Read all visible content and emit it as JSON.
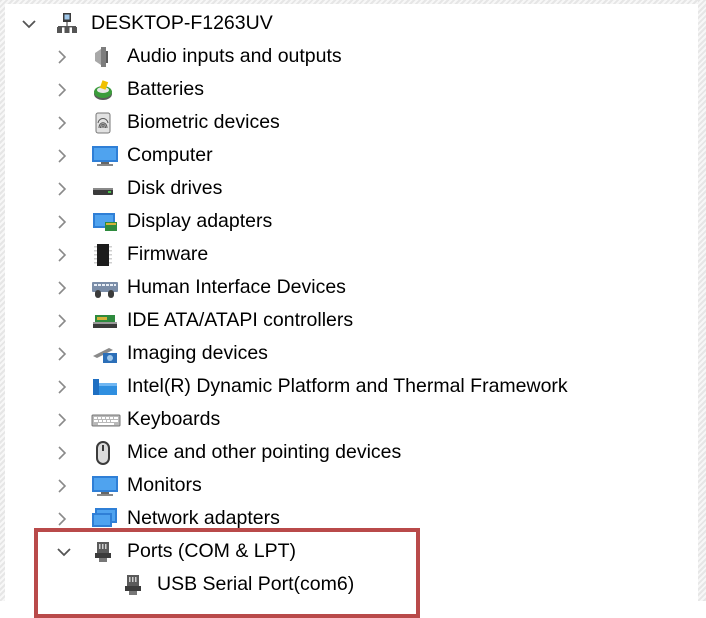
{
  "tree": {
    "root": {
      "label": "DESKTOP-F1263UV",
      "icon": "computer-network-icon",
      "expanded": true
    },
    "categories": [
      {
        "label": "Audio inputs and outputs",
        "icon": "speaker-icon",
        "expanded": false
      },
      {
        "label": "Batteries",
        "icon": "battery-icon",
        "expanded": false
      },
      {
        "label": "Biometric devices",
        "icon": "fingerprint-icon",
        "expanded": false
      },
      {
        "label": "Computer",
        "icon": "monitor-icon",
        "expanded": false
      },
      {
        "label": "Disk drives",
        "icon": "disk-drive-icon",
        "expanded": false
      },
      {
        "label": "Display adapters",
        "icon": "display-adapter-icon",
        "expanded": false
      },
      {
        "label": "Firmware",
        "icon": "chip-icon",
        "expanded": false
      },
      {
        "label": "Human Interface Devices",
        "icon": "hid-icon",
        "expanded": false
      },
      {
        "label": "IDE ATA/ATAPI controllers",
        "icon": "ide-controller-icon",
        "expanded": false
      },
      {
        "label": "Imaging devices",
        "icon": "camera-icon",
        "expanded": false
      },
      {
        "label": "Intel(R) Dynamic Platform and Thermal Framework",
        "icon": "folder-icon",
        "expanded": false
      },
      {
        "label": "Keyboards",
        "icon": "keyboard-icon",
        "expanded": false
      },
      {
        "label": "Mice and other pointing devices",
        "icon": "mouse-icon",
        "expanded": false
      },
      {
        "label": "Monitors",
        "icon": "monitor-icon",
        "expanded": false
      },
      {
        "label": "Network adapters",
        "icon": "network-adapter-icon",
        "expanded": false
      },
      {
        "label": "Ports (COM & LPT)",
        "icon": "port-icon",
        "expanded": true
      }
    ],
    "ports_children": [
      {
        "label": "USB Serial Port(com6)",
        "icon": "port-icon"
      }
    ]
  },
  "colors": {
    "highlight_border": "#b94a4a",
    "chevron": "#6b6b6b",
    "text": "#000000"
  }
}
